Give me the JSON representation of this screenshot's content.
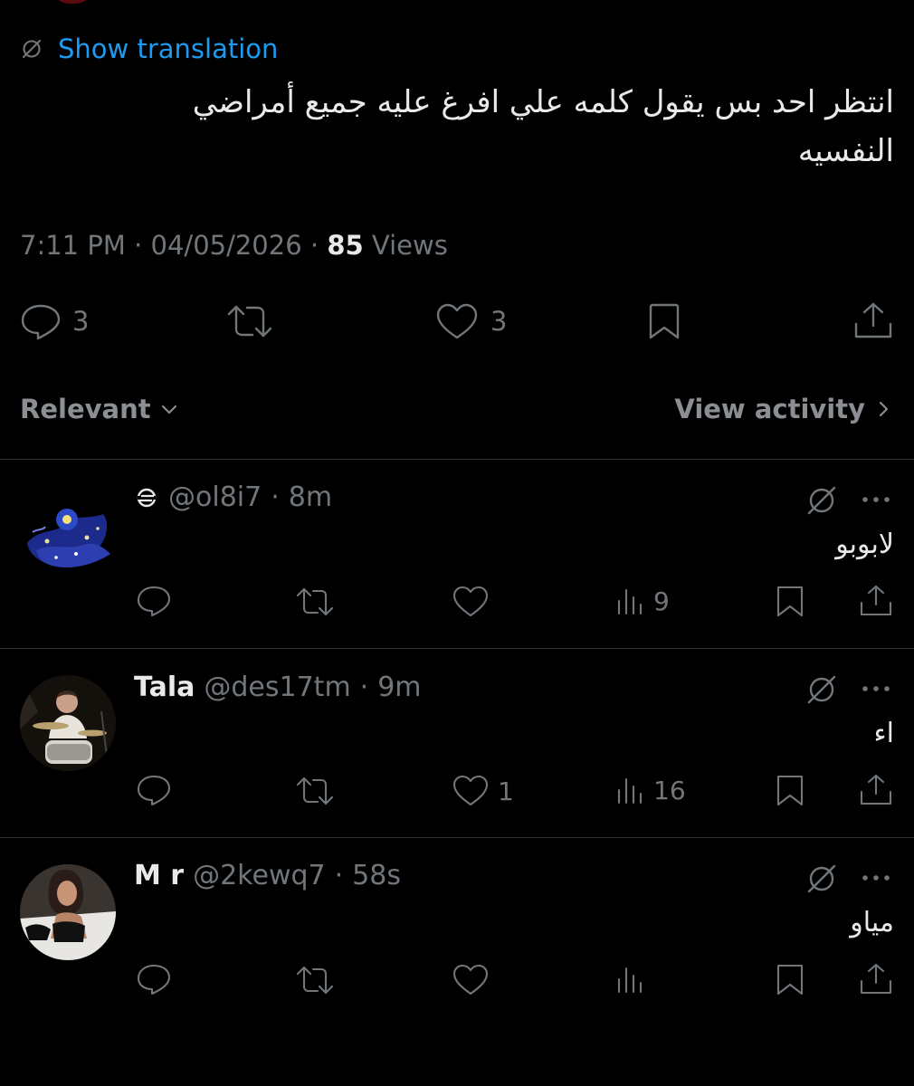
{
  "tweet": {
    "translate_label": "Show translation",
    "body": "انتظر احد بس يقول كلمه علي افرغ عليه جميع أمراضي النفسيه",
    "time": "7:11 PM",
    "date": "04/05/2026",
    "views_count": "85",
    "views_label": "Views",
    "reply_count": "3",
    "like_count": "3"
  },
  "sort": {
    "label": "Relevant",
    "activity_label": "View activity"
  },
  "replies": [
    {
      "name": "",
      "handle": "@ol8i7",
      "time": "8m",
      "text": "لابوبو",
      "likes": "",
      "views": "9"
    },
    {
      "name": "Tala",
      "handle": "@des17tm",
      "time": "9m",
      "text": "اء",
      "likes": "1",
      "views": "16"
    },
    {
      "name": "M r",
      "handle": "@2kewq7",
      "time": "58s",
      "text": "مياو",
      "likes": "",
      "views": ""
    }
  ],
  "colors": {
    "background": "#000000",
    "link": "#1d9bf0",
    "muted": "#71767b",
    "text": "#e7e9ea"
  }
}
